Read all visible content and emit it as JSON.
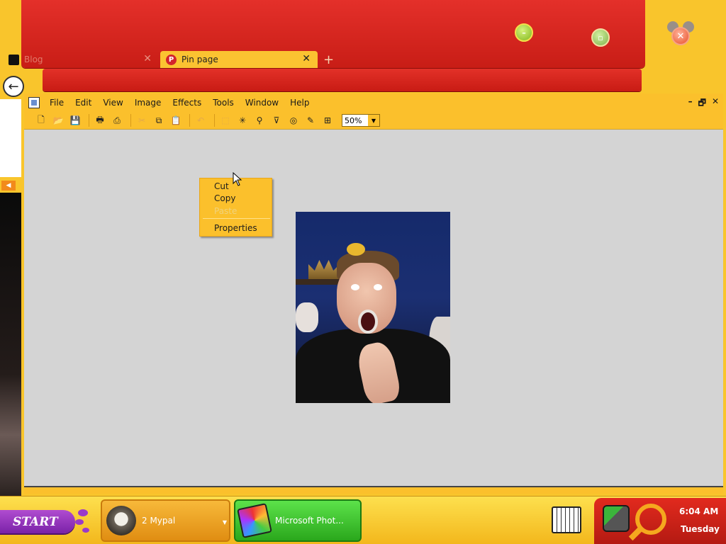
{
  "browser": {
    "tabs": [
      {
        "title": "Blog",
        "close": "✕"
      },
      {
        "title": "Pin page",
        "close": "✕"
      }
    ],
    "new_tab": "+",
    "back": "←"
  },
  "photo_editor": {
    "menu": [
      "File",
      "Edit",
      "View",
      "Image",
      "Effects",
      "Tools",
      "Window",
      "Help"
    ],
    "window_controls": [
      "–",
      "🗗",
      "✕"
    ],
    "zoom": "50%"
  },
  "context_menu": {
    "items": [
      {
        "label": "Cut",
        "enabled": true
      },
      {
        "label": "Copy",
        "enabled": true
      },
      {
        "label": "Paste",
        "enabled": false
      },
      {
        "label": "Properties",
        "enabled": true
      }
    ]
  },
  "taskbar": {
    "start_label": "START",
    "tasks": [
      {
        "label": "2 Mypal",
        "icon": "raccoon-icon"
      },
      {
        "label": "Microsoft Phot...",
        "icon": "photo-editor-icon"
      }
    ],
    "clock": {
      "time": "6:04 AM",
      "day": "Tuesday"
    }
  },
  "colors": {
    "theme_yellow": "#fbc02c",
    "theme_red": "#c81d16",
    "start_purple": "#8a2ab8",
    "canvas_gray": "#d4d4d4"
  }
}
